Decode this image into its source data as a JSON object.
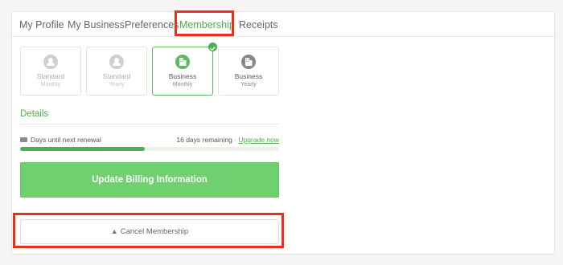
{
  "tabs": [
    {
      "label": "My Profile"
    },
    {
      "label": "My Business"
    },
    {
      "label": "Preferences"
    },
    {
      "label": "Membership"
    },
    {
      "label": "Receipts"
    }
  ],
  "active_tab": "Membership",
  "plans": [
    {
      "name": "Standard",
      "period": "Monthly",
      "icon": "person-icon",
      "state": "inactive"
    },
    {
      "name": "Standard",
      "period": "Yearly",
      "icon": "person-icon",
      "state": "inactive"
    },
    {
      "name": "Business",
      "period": "Monthly",
      "icon": "building-icon",
      "state": "selected"
    },
    {
      "name": "Business",
      "period": "Yearly",
      "icon": "building-icon",
      "state": "available"
    }
  ],
  "details": {
    "title": "Details",
    "renewal_label": "Days until next renewal",
    "remaining_text": "16 days remaining",
    "separator": "·",
    "upgrade_link": "Upgrade now",
    "progress_fraction": 0.48
  },
  "buttons": {
    "update_billing": "Update Billing Information",
    "cancel_membership": "Cancel Membership"
  },
  "colors": {
    "accent": "#4cae4c",
    "button_green": "#6fd06f",
    "highlight_red": "#e4321b"
  }
}
